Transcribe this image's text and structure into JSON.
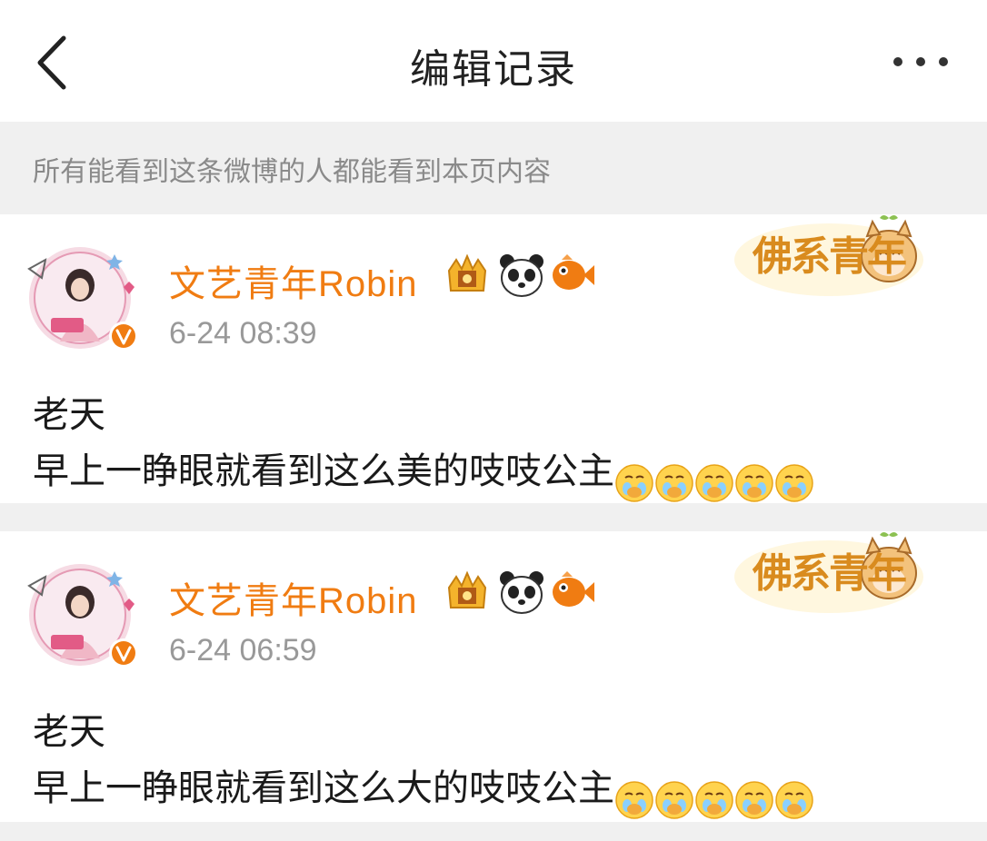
{
  "header": {
    "title": "编辑记录",
    "back_icon": "chevron-left-icon",
    "more_icon": "more-horizontal-icon"
  },
  "notice": {
    "text": "所有能看到这条微博的人都能看到本页内容"
  },
  "colors": {
    "username": "#f07c12",
    "timestamp": "#999999",
    "notice_bg": "#f0f0f0",
    "notice_text": "#8a8a8a"
  },
  "records": [
    {
      "username": "文艺青年Robin",
      "timestamp": "6-24 08:39",
      "badges": [
        "crown-badge-icon",
        "panda-badge-icon",
        "fish-badge-icon"
      ],
      "sticker_text": "佛系青年",
      "line1": "老天",
      "line2": "早上一睁眼就看到这么美的吱吱公主",
      "emoji": "crying-face-icon",
      "emoji_count": 5
    },
    {
      "username": "文艺青年Robin",
      "timestamp": "6-24 06:59",
      "badges": [
        "crown-badge-icon",
        "panda-badge-icon",
        "fish-badge-icon"
      ],
      "sticker_text": "佛系青年",
      "line1": "老天",
      "line2": "早上一睁眼就看到这么大的吱吱公主",
      "emoji": "crying-face-icon",
      "emoji_count": 5
    }
  ]
}
